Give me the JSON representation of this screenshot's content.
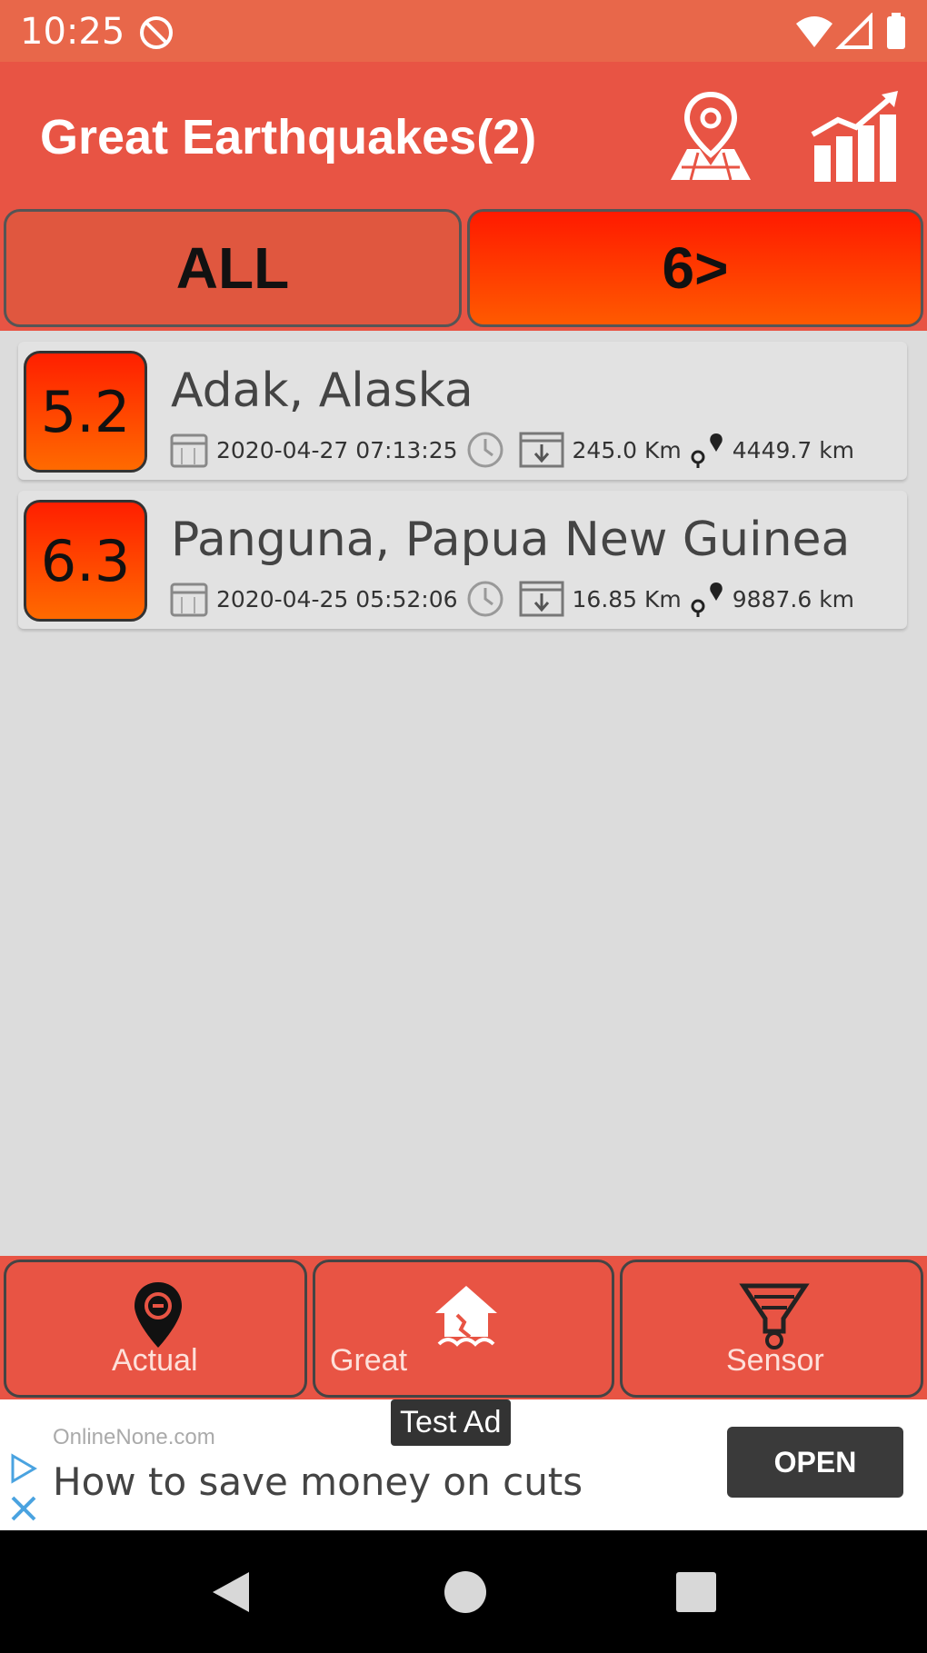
{
  "status_bar": {
    "time": "10:25"
  },
  "app_bar": {
    "title": "Great Earthquakes(2)"
  },
  "filters": {
    "all_label": "ALL",
    "six_label": "6>"
  },
  "earthquakes": [
    {
      "magnitude": "5.2",
      "place": "Adak, Alaska",
      "datetime": "2020-04-27 07:13:25",
      "depth": "245.0 Km",
      "distance": "4449.7 km"
    },
    {
      "magnitude": "6.3",
      "place": "Panguna, Papua New Guinea",
      "datetime": "2020-04-25 05:52:06",
      "depth": "16.85 Km",
      "distance": "9887.6 km"
    }
  ],
  "bottom_nav": {
    "actual": "Actual",
    "great": "Great",
    "sensor": "Sensor"
  },
  "ad": {
    "badge": "Test Ad",
    "source": "OnlineNone.com",
    "text": "How to save money on cuts",
    "open": "OPEN"
  },
  "colors": {
    "primary": "#e85444",
    "magnitude_gradient": [
      "#ff1f00",
      "#ff6a00"
    ],
    "background": "#dcdcdc"
  }
}
